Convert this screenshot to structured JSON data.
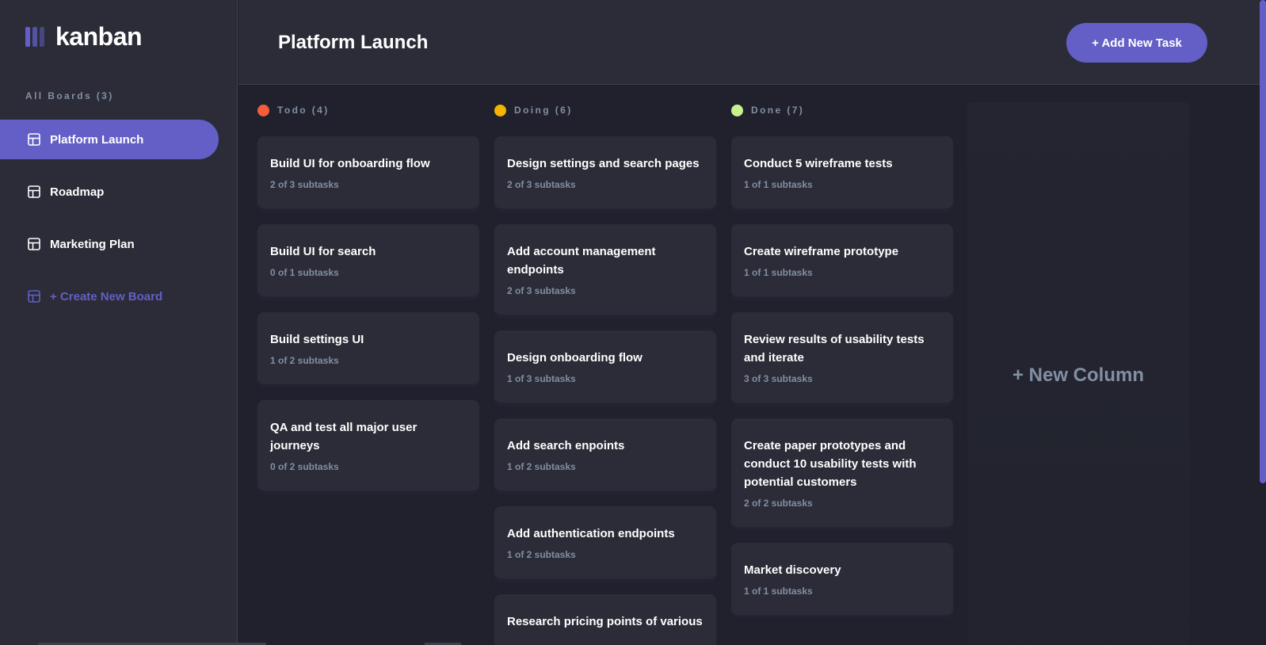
{
  "app": {
    "logo_text": "kanban"
  },
  "sidebar": {
    "heading": "All Boards (3)",
    "boards": [
      {
        "label": "Platform Launch",
        "active": true
      },
      {
        "label": "Roadmap",
        "active": false
      },
      {
        "label": "Marketing Plan",
        "active": false
      }
    ],
    "create_label": "+ Create New Board"
  },
  "header": {
    "title": "Platform Launch",
    "add_task_label": "+ Add New Task"
  },
  "columns": [
    {
      "title": "Todo (4)",
      "color": "#f25d3a",
      "tasks": [
        {
          "title": "Build UI for onboarding flow",
          "subtasks": "2 of 3 subtasks"
        },
        {
          "title": "Build UI for search",
          "subtasks": "0 of 1 subtasks"
        },
        {
          "title": "Build settings UI",
          "subtasks": "1 of 2 subtasks"
        },
        {
          "title": "QA and test all major user journeys",
          "subtasks": "0 of 2 subtasks"
        }
      ]
    },
    {
      "title": "Doing (6)",
      "color": "#f5b400",
      "tasks": [
        {
          "title": "Design settings and search pages",
          "subtasks": "2 of 3 subtasks"
        },
        {
          "title": "Add account management endpoints",
          "subtasks": "2 of 3 subtasks"
        },
        {
          "title": "Design onboarding flow",
          "subtasks": "1 of 3 subtasks"
        },
        {
          "title": "Add search enpoints",
          "subtasks": "1 of 2 subtasks"
        },
        {
          "title": "Add authentication endpoints",
          "subtasks": "1 of 2 subtasks"
        },
        {
          "title": "Research pricing points of various",
          "subtasks": ""
        }
      ]
    },
    {
      "title": "Done (7)",
      "color": "#c8f08f",
      "tasks": [
        {
          "title": "Conduct 5 wireframe tests",
          "subtasks": "1 of 1 subtasks"
        },
        {
          "title": "Create wireframe prototype",
          "subtasks": "1 of 1 subtasks"
        },
        {
          "title": "Review results of usability tests and iterate",
          "subtasks": "3 of 3 subtasks"
        },
        {
          "title": "Create paper prototypes and conduct 10 usability tests with potential customers",
          "subtasks": "2 of 2 subtasks"
        },
        {
          "title": "Market discovery",
          "subtasks": "1 of 1 subtasks"
        }
      ]
    }
  ],
  "new_column_label": "+ New Column",
  "colors": {
    "accent": "#635fc7",
    "background": "#20212c",
    "panel": "#2b2c37",
    "muted_text": "#828fa3"
  }
}
